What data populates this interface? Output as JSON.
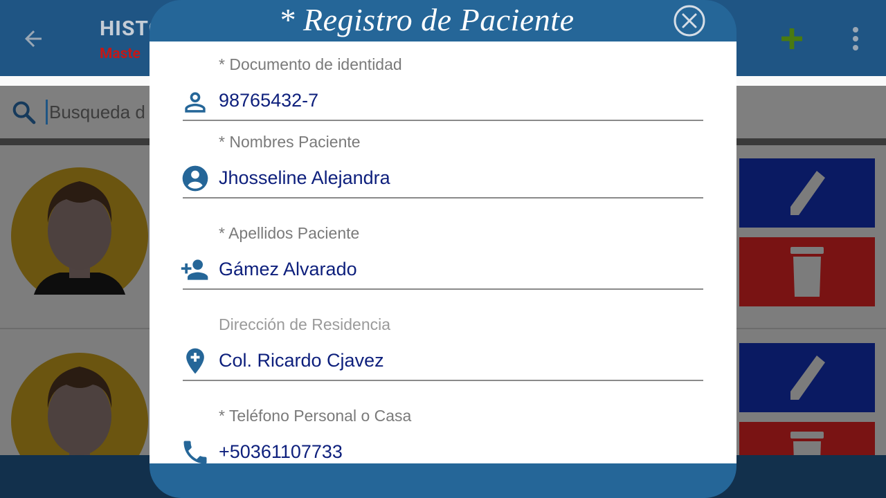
{
  "appbar": {
    "title": "HISTO",
    "subtitle": "Maste",
    "back_icon": "arrow-left-icon",
    "add_icon": "plus-icon",
    "more_icon": "more-vert-icon",
    "accent": "#1f5584",
    "add_color": "#4a7a10"
  },
  "search": {
    "placeholder": "Busqueda d"
  },
  "dialog": {
    "title": "* Registro de Paciente",
    "close_icon": "close-circle-icon",
    "fields": [
      {
        "label": "* Documento de identidad",
        "value": "98765432-7",
        "icon": "person-outline-icon"
      },
      {
        "label": "* Nombres Paciente",
        "value": "Jhosseline Alejandra",
        "icon": "account-circle-icon"
      },
      {
        "label": "* Apellidos Paciente",
        "value": "Gámez Alvarado",
        "icon": "person-add-icon"
      },
      {
        "label": "Dirección de Residencia",
        "value": "Col. Ricardo Cjavez",
        "icon": "add-location-icon"
      },
      {
        "label": "* Teléfono Personal o Casa",
        "value": "+50361107733",
        "icon": "phone-icon"
      }
    ],
    "header_color": "#256698",
    "value_color": "#0d1f7c"
  },
  "list": {
    "rows": [
      {
        "avatar_icon": "user-avatar-icon",
        "edit_icon": "pencil-icon",
        "delete_icon": "trash-icon"
      },
      {
        "avatar_icon": "user-avatar-icon",
        "edit_icon": "pencil-icon",
        "delete_icon": "trash-icon"
      }
    ],
    "edit_color": "#0a1a62",
    "delete_color": "#791313"
  }
}
